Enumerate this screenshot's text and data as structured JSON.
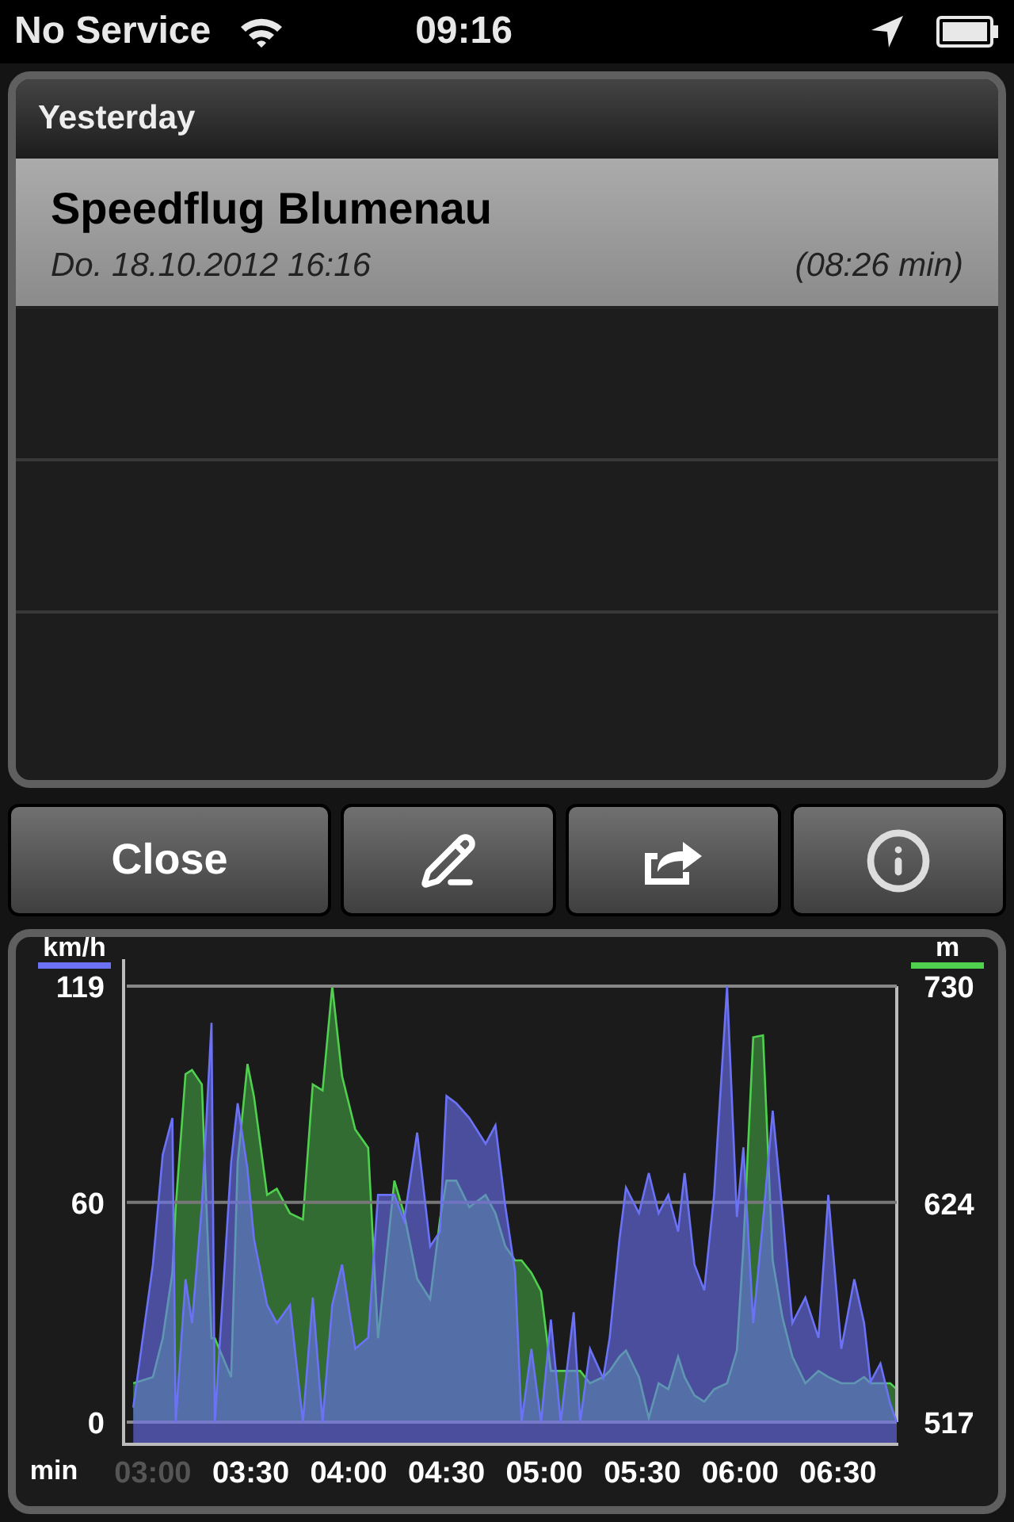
{
  "status_bar": {
    "carrier": "No Service",
    "time": "09:16"
  },
  "list": {
    "section": "Yesterday",
    "rows": [
      {
        "title": "Speedflug Blumenau",
        "date": "Do. 18.10.2012 16:16",
        "duration": "(08:26 min)",
        "selected": true
      }
    ]
  },
  "buttons": [
    {
      "kind": "text",
      "label": "Close"
    },
    {
      "kind": "icon"
    },
    {
      "kind": "icon"
    },
    {
      "kind": "icon"
    }
  ],
  "altitude_chart": {
    "chart_data": {
      "type": "area",
      "xlim": [
        172,
        408
      ],
      "ylim": [
        517,
        730
      ],
      "yticks": [
        517,
        624,
        730
      ],
      "x": [
        174,
        180,
        183,
        186,
        187,
        190,
        192,
        195,
        198,
        199,
        204,
        206,
        209,
        211,
        215,
        218,
        222,
        226,
        229,
        232,
        235,
        238,
        242,
        246,
        249,
        254,
        257,
        261,
        265,
        268,
        270,
        273,
        277,
        282,
        285,
        288,
        291,
        293,
        296,
        299,
        302,
        305,
        309,
        311,
        314,
        318,
        320,
        323,
        325,
        329,
        332,
        335,
        338,
        341,
        343,
        346,
        349,
        352,
        356,
        359,
        361,
        364,
        367,
        370,
        373,
        376,
        380,
        384,
        387,
        391,
        395,
        398,
        400,
        403,
        406,
        408
      ],
      "series": [
        {
          "name": "m",
          "color": "#4fd04f",
          "values": [
            536,
            539,
            558,
            590,
            622,
            687,
            689,
            682,
            558,
            558,
            539,
            644,
            692,
            676,
            628,
            631,
            619,
            616,
            682,
            679,
            730,
            686,
            660,
            651,
            558,
            635,
            619,
            587,
            577,
            616,
            635,
            635,
            622,
            628,
            619,
            603,
            596,
            596,
            590,
            581,
            542,
            542,
            542,
            542,
            536,
            539,
            542,
            549,
            552,
            539,
            519,
            536,
            533,
            549,
            539,
            530,
            527,
            533,
            536,
            552,
            603,
            705,
            706,
            596,
            568,
            549,
            536,
            542,
            539,
            536,
            536,
            539,
            536,
            536,
            536,
            533
          ]
        }
      ]
    }
  },
  "speed_chart": {
    "chart_data": {
      "type": "area",
      "xlabel": "min",
      "xlim": [
        172,
        408
      ],
      "ylim": [
        0,
        119
      ],
      "yticks": [
        0,
        60,
        119
      ],
      "xticks": [
        {
          "value": 180,
          "label": "03:00"
        },
        {
          "value": 210,
          "label": "03:30"
        },
        {
          "value": 240,
          "label": "04:00"
        },
        {
          "value": 270,
          "label": "04:30"
        },
        {
          "value": 300,
          "label": "05:00"
        },
        {
          "value": 330,
          "label": "05:30"
        },
        {
          "value": 360,
          "label": "06:00"
        },
        {
          "value": 390,
          "label": "06:30"
        }
      ],
      "x": [
        174,
        180,
        183,
        186,
        187,
        190,
        192,
        195,
        198,
        199,
        204,
        206,
        209,
        211,
        215,
        218,
        222,
        226,
        229,
        232,
        235,
        238,
        242,
        246,
        249,
        254,
        257,
        261,
        265,
        268,
        270,
        273,
        277,
        282,
        285,
        288,
        291,
        293,
        296,
        299,
        302,
        305,
        309,
        311,
        314,
        318,
        320,
        323,
        325,
        329,
        332,
        335,
        338,
        341,
        343,
        346,
        349,
        352,
        356,
        359,
        361,
        364,
        367,
        370,
        373,
        376,
        380,
        384,
        387,
        391,
        395,
        398,
        400,
        403,
        406,
        408
      ],
      "series": [
        {
          "name": "km/h",
          "color": "#6b72f5",
          "values": [
            4,
            43,
            73,
            83,
            0,
            39,
            27,
            59,
            109,
            0,
            71,
            87,
            69,
            50,
            32,
            27,
            32,
            0,
            34,
            0,
            32,
            43,
            20,
            23,
            62,
            62,
            55,
            79,
            48,
            52,
            89,
            87,
            83,
            76,
            81,
            59,
            41,
            0,
            20,
            0,
            28,
            0,
            30,
            0,
            20,
            12,
            23,
            50,
            64,
            57,
            68,
            57,
            62,
            52,
            68,
            43,
            36,
            62,
            119,
            56,
            75,
            27,
            55,
            85,
            57,
            27,
            34,
            23,
            62,
            20,
            39,
            27,
            11,
            16,
            5,
            0
          ]
        }
      ]
    }
  }
}
